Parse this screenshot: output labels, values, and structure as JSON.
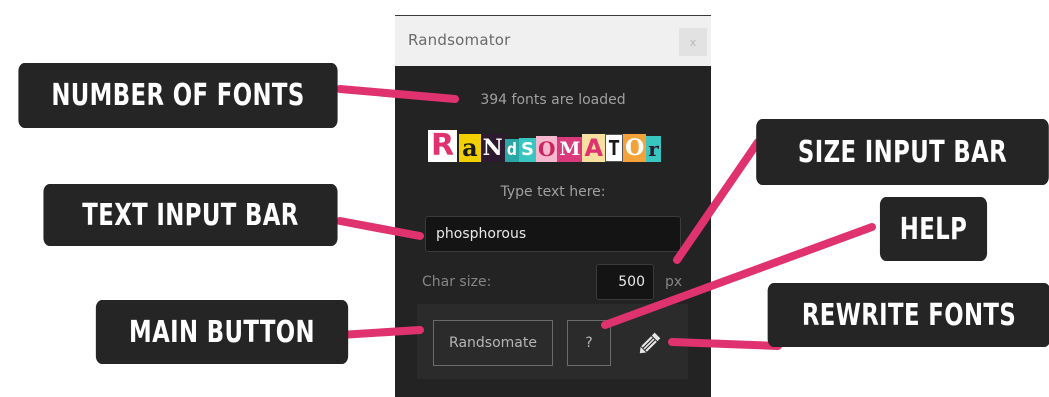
{
  "panel": {
    "title": "Randsomator",
    "close_glyph": "x",
    "font_count_status": "394 fonts are loaded",
    "logo_text": "RANDSOMATOR",
    "text_prompt": "Type text here:",
    "text_value": "phosphorous",
    "char_size_label": "Char size:",
    "char_size_value": "500",
    "char_size_unit": "px",
    "main_button_label": "Randsomate",
    "help_button_label": "?",
    "rewrite_icon": "pencil-icon"
  },
  "callouts": {
    "number_of_fonts": "NUMBER OF FONTS",
    "text_input_bar": "TEXT INPUT BAR",
    "main_button": "MAIN BUTTON",
    "size_input_bar": "SIZE INPUT BAR",
    "help": "HELP",
    "rewrite_fonts": "REWRITE FONTS"
  },
  "colors": {
    "panel_bg": "#232323",
    "callout_bg": "#252525",
    "accent_pink": "#e0326e"
  }
}
